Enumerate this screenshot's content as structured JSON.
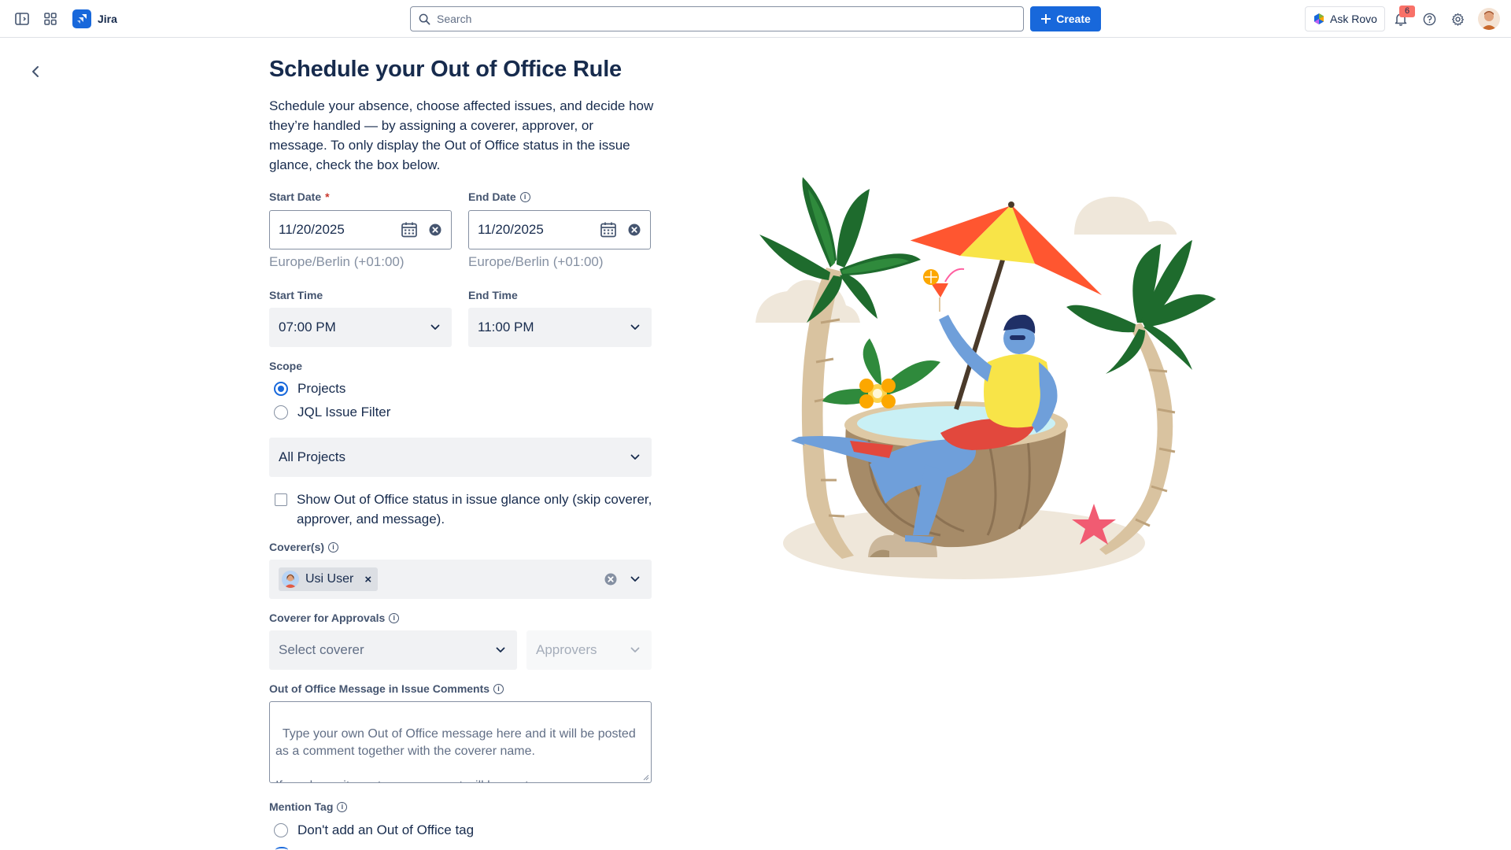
{
  "app": {
    "name": "Jira"
  },
  "topbar": {
    "search_placeholder": "Search",
    "create_label": "Create",
    "ask_rovo_label": "Ask Rovo",
    "notification_count": "6"
  },
  "page": {
    "title": "Schedule your Out of Office Rule",
    "description": "Schedule your absence, choose affected issues, and decide how they’re handled — by assigning a coverer, approver, or message. To only display the Out of Office status in the issue glance, check the box below."
  },
  "form": {
    "start_date": {
      "label": "Start Date",
      "required_mark": "*",
      "value": "11/20/2025",
      "timezone": "Europe/Berlin (+01:00)"
    },
    "end_date": {
      "label": "End Date",
      "value": "11/20/2025",
      "timezone": "Europe/Berlin (+01:00)"
    },
    "start_time": {
      "label": "Start Time",
      "value": "07:00 PM"
    },
    "end_time": {
      "label": "End Time",
      "value": "11:00 PM"
    },
    "scope": {
      "label": "Scope",
      "options": [
        "Projects",
        "JQL Issue Filter"
      ],
      "selected": "Projects"
    },
    "projects_select": {
      "value": "All Projects"
    },
    "glance_only": {
      "label": "Show Out of Office status in issue glance only (skip coverer, approver, and message).",
      "checked": false
    },
    "coverers": {
      "label": "Coverer(s)",
      "chips": [
        "Usi User"
      ]
    },
    "approvals": {
      "label": "Coverer for Approvals",
      "coverer_placeholder": "Select coverer",
      "approvers_placeholder": "Approvers"
    },
    "message": {
      "label": "Out of Office Message in Issue Comments",
      "placeholder": "Type your own Out of Office message here and it will be posted as a comment together with the coverer name.\n\nIf you leave it empty, no comment will be sent."
    },
    "mention_tag": {
      "label": "Mention Tag",
      "options": [
        "Don't add an Out of Office tag"
      ]
    }
  },
  "colors": {
    "brand_blue": "#1868db",
    "text": "#172b4d",
    "subtle_text": "#44546f",
    "timezone_text": "#8590a2",
    "select_bg": "#f1f2f4",
    "required_red": "#c9372c"
  }
}
